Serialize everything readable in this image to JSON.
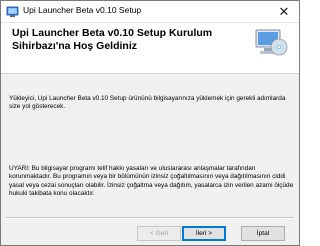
{
  "window": {
    "title": "Upi Launcher Beta v0.10 Setup",
    "close_glyph": "✕"
  },
  "banner": {
    "heading": "Upi Launcher Beta v0.10 Setup Kurulum Sihirbazı'na Hoş Geldiniz",
    "icon": "computer-cd-icon"
  },
  "body": {
    "intro": "Yükleyici, Upi Launcher Beta v0.10 Setup ürününü bilgisayarınıza yüklemek için gerekli adımlarda size yol gösterecek.",
    "warning": "UYARI: Bu bilgisayar programı telif hakkı yasaları ve uluslararası anlaşmalar tarafından korunmaktadır. Bu programın veya bir bölümünün izinsiz çoğaltılmasının veya dağıtılmasının ciddi yasal veya cezai sonuçları olabilir. İzinsiz çoğaltma veya dağıtım, yasalarca izin verilen azami ölçüde hukuki takibata konu olacaktır."
  },
  "buttons": {
    "back": "< Geri",
    "next": "İleri >",
    "cancel": "İptal"
  }
}
